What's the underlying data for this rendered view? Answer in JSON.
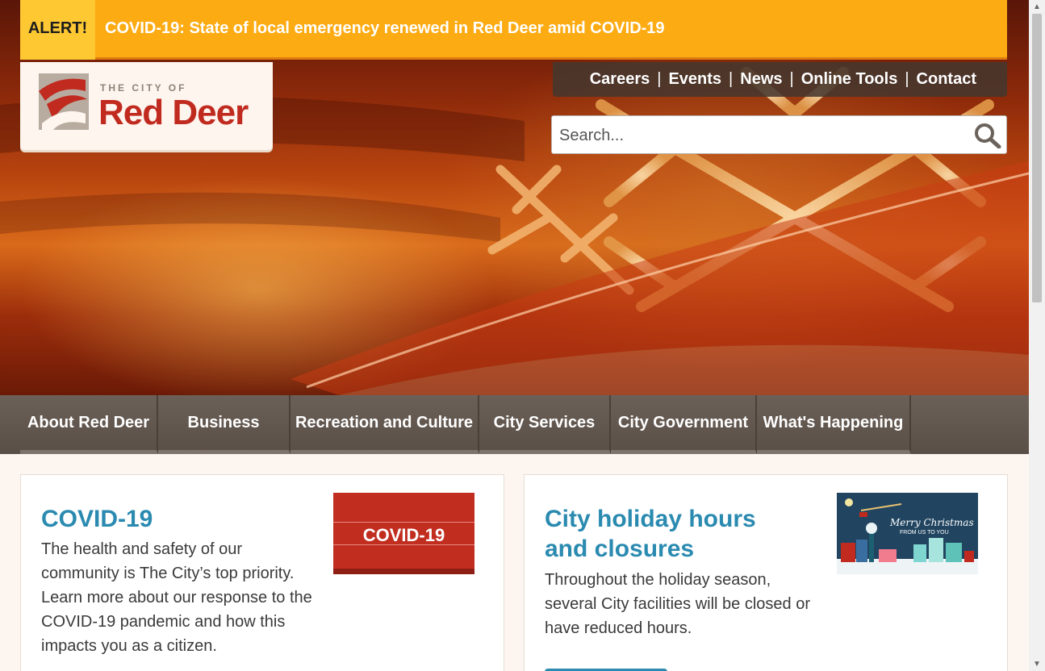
{
  "alert": {
    "label": "ALERT!",
    "message": "COVID-19: State of local emergency renewed in Red Deer amid COVID-19"
  },
  "logo": {
    "small_text": "THE CITY OF",
    "big_text": "Red Deer"
  },
  "top_links": [
    {
      "label": "Careers"
    },
    {
      "label": "Events"
    },
    {
      "label": "News"
    },
    {
      "label": "Online Tools"
    },
    {
      "label": "Contact"
    }
  ],
  "search": {
    "placeholder": "Search..."
  },
  "main_nav": [
    {
      "label": "About Red Deer"
    },
    {
      "label": "Business"
    },
    {
      "label": "Recreation and Culture"
    },
    {
      "label": "City Services"
    },
    {
      "label": "City Government"
    },
    {
      "label": "What's Happening"
    }
  ],
  "cards": [
    {
      "title": "COVID-19",
      "body": "The health and safety of our community is The City’s top priority. Learn more about our response to the COVID-19 pandemic and how this impacts you as a citizen.",
      "image_text": "COVID-19"
    },
    {
      "title": "City holiday hours and closures",
      "body": "Throughout the holiday season, several City facilities will be closed or have reduced hours.",
      "image_text": "Merry Christmas",
      "image_subtext": "FROM US TO YOU"
    }
  ],
  "colors": {
    "alert_bg": "#fdab13",
    "brand_red": "#c12a1f",
    "card_title": "#2a8ab0",
    "nav_bg": "#5a4f47"
  }
}
